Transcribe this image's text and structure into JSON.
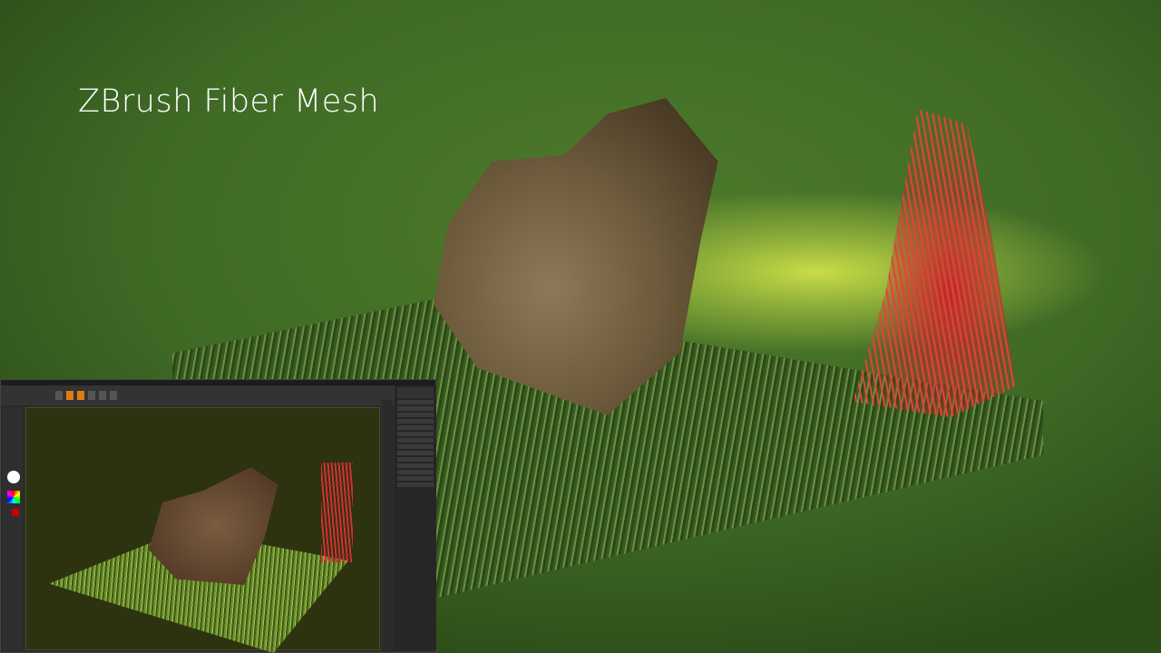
{
  "hero": {
    "title": "ZBrush Fiber Mesh"
  },
  "colors": {
    "accent": "#e07b14",
    "background": "#5a7f36",
    "fiber_red": "#d23030"
  }
}
